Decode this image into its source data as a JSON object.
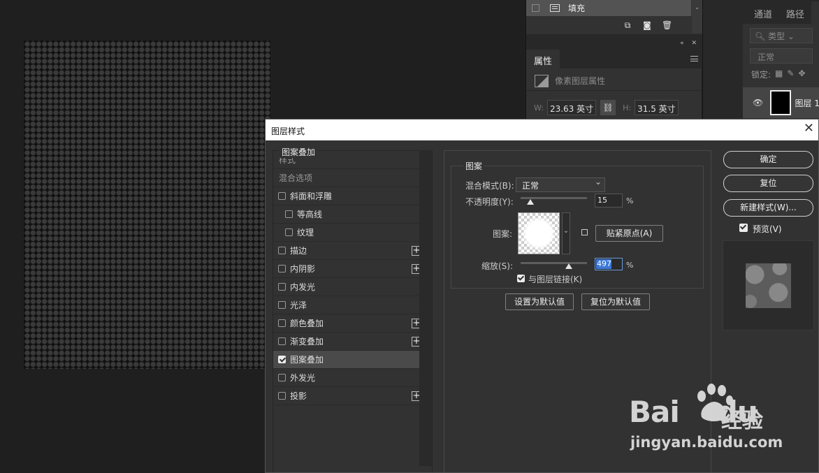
{
  "layers_panel_top": {
    "fill_layer_label": "填充"
  },
  "properties": {
    "tab": "属性",
    "pixel_layer_label": "像素图层属性",
    "w_label": "W:",
    "w_value": "23.63 英寸",
    "h_label": "H:",
    "h_value": "31.5 英寸"
  },
  "right_panel": {
    "tabs": [
      "通道",
      "路径"
    ],
    "kind_search": "类型",
    "blend": "正常",
    "lock_label": "锁定:",
    "layer_name": "图层 1"
  },
  "dialog": {
    "title": "图层样式",
    "style_list": [
      {
        "label": "样式",
        "kind": "header"
      },
      {
        "label": "混合选项",
        "kind": "header"
      },
      {
        "label": "斜面和浮雕",
        "kind": "item",
        "checked": false,
        "plus": false
      },
      {
        "label": "等高线",
        "kind": "sub",
        "checked": false,
        "plus": false
      },
      {
        "label": "纹理",
        "kind": "sub",
        "checked": false,
        "plus": false
      },
      {
        "label": "描边",
        "kind": "item",
        "checked": false,
        "plus": true
      },
      {
        "label": "内阴影",
        "kind": "item",
        "checked": false,
        "plus": true
      },
      {
        "label": "内发光",
        "kind": "item",
        "checked": false,
        "plus": false
      },
      {
        "label": "光泽",
        "kind": "item",
        "checked": false,
        "plus": false
      },
      {
        "label": "颜色叠加",
        "kind": "item",
        "checked": false,
        "plus": true
      },
      {
        "label": "渐变叠加",
        "kind": "item",
        "checked": false,
        "plus": true
      },
      {
        "label": "图案叠加",
        "kind": "item",
        "checked": true,
        "plus": false
      },
      {
        "label": "外发光",
        "kind": "item",
        "checked": false,
        "plus": false
      },
      {
        "label": "投影",
        "kind": "item",
        "checked": false,
        "plus": true
      }
    ],
    "section_title": "图案叠加",
    "group_title": "图案",
    "blend_label": "混合模式(B):",
    "blend_value": "正常",
    "opacity_label": "不透明度(Y):",
    "opacity_value": "15",
    "opacity_fraction": 0.15,
    "percent": "%",
    "pattern_label": "图案:",
    "snap_origin": "贴紧原点(A)",
    "scale_label": "缩放(S):",
    "scale_value": "497",
    "link_label": "与图层链接(K)",
    "link_checked": true,
    "set_default": "设置为默认值",
    "reset_default": "复位为默认值",
    "ok": "确定",
    "reset": "复位",
    "new_style": "新建样式(W)...",
    "preview": "预览(V)",
    "preview_checked": true
  },
  "watermark": {
    "brand": "Bai",
    "brand2": "du",
    "cn": "经验",
    "url": "jingyan.baidu.com"
  }
}
